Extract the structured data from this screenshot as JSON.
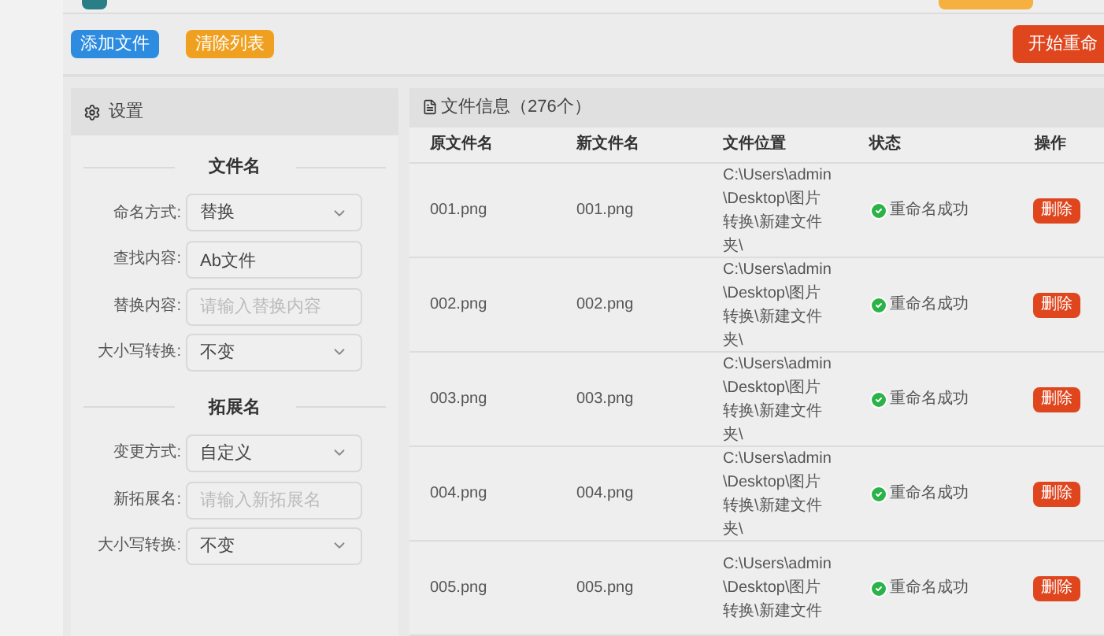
{
  "toolbar": {
    "buttons": [
      {
        "label": "添加文件",
        "kind": "primary"
      },
      {
        "label": "清除列表",
        "kind": "warning"
      }
    ],
    "start_button": "开始重命"
  },
  "settings": {
    "title": "设置",
    "sections": [
      {
        "title": "文件名",
        "fields": [
          {
            "label": "命名方式:",
            "kind": "select",
            "value": "替换"
          },
          {
            "label": "查找内容:",
            "kind": "input",
            "value": "Ab文件"
          },
          {
            "label": "替换内容:",
            "kind": "input",
            "placeholder": "请输入替换内容"
          },
          {
            "label": "大小写转换:",
            "kind": "select",
            "value": "不变"
          }
        ]
      },
      {
        "title": "拓展名",
        "fields": [
          {
            "label": "变更方式:",
            "kind": "select",
            "value": "自定义"
          },
          {
            "label": "新拓展名:",
            "kind": "input",
            "placeholder": "请输入新拓展名"
          },
          {
            "label": "大小写转换:",
            "kind": "select",
            "value": "不变"
          }
        ]
      }
    ]
  },
  "files": {
    "title": "文件信息（276个）",
    "columns": [
      "原文件名",
      "新文件名",
      "文件位置",
      "状态",
      "操作"
    ],
    "rows": [
      {
        "original": "001.png",
        "new": "001.png",
        "path": "C:\\Users\\admin\\Desktop\\图片转换\\新建文件夹\\",
        "status": "重命名成功",
        "success": true,
        "action": "删除"
      },
      {
        "original": "002.png",
        "new": "002.png",
        "path": "C:\\Users\\admin\\Desktop\\图片转换\\新建文件夹\\",
        "status": "重命名成功",
        "success": true,
        "action": "删除"
      },
      {
        "original": "003.png",
        "new": "003.png",
        "path": "C:\\Users\\admin\\Desktop\\图片转换\\新建文件夹\\",
        "status": "重命名成功",
        "success": true,
        "action": "删除"
      },
      {
        "original": "004.png",
        "new": "004.png",
        "path": "C:\\Users\\admin\\Desktop\\图片转换\\新建文件夹\\",
        "status": "重命名成功",
        "success": true,
        "action": "删除"
      },
      {
        "original": "005.png",
        "new": "005.png",
        "path": "C:\\Users\\admin\\Desktop\\图片转换\\新建文件",
        "status": "重命名成功",
        "success": true,
        "action": "删除"
      }
    ]
  }
}
